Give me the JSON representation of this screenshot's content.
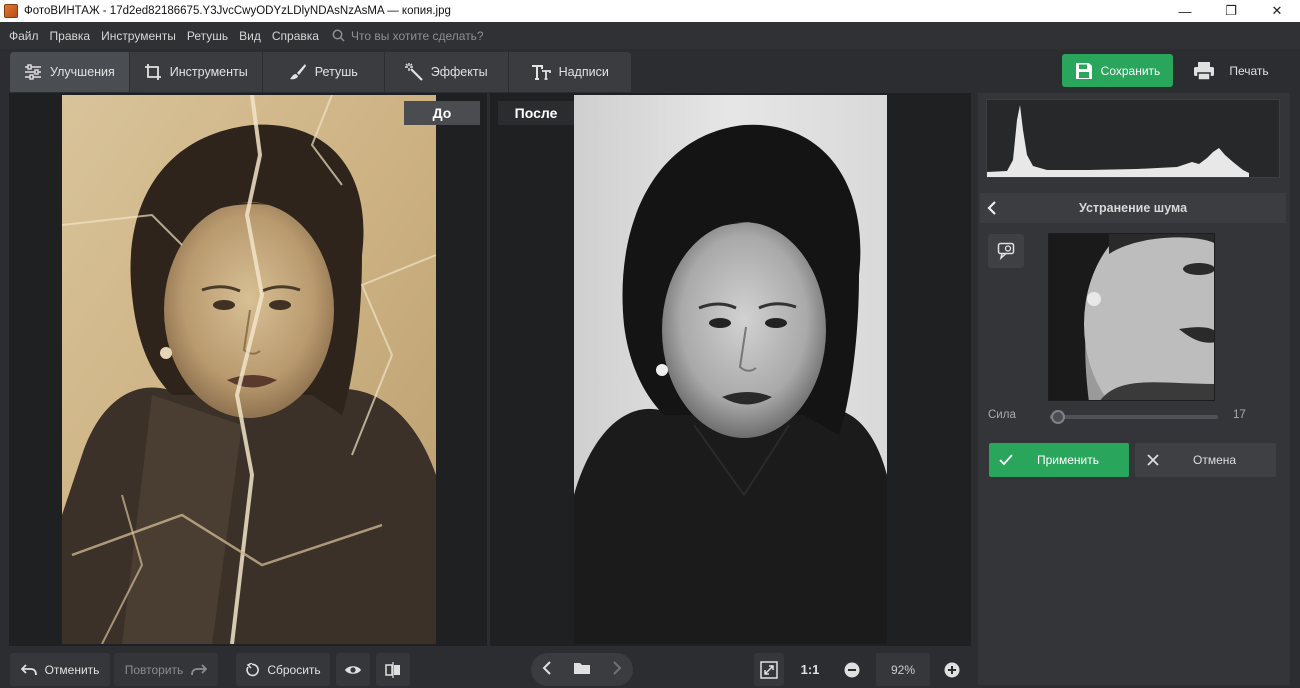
{
  "window": {
    "title": "ФотоВИНТАЖ - 17d2ed82186675.Y3JvcCwyODYzLDlyNDAsNzAsMA — копия.jpg",
    "minimize": "—",
    "maximize": "❐",
    "close": "✕"
  },
  "menu": {
    "items": [
      "Файл",
      "Правка",
      "Инструменты",
      "Ретушь",
      "Вид",
      "Справка"
    ],
    "search_placeholder": "Что вы хотите сделать?"
  },
  "tabs": [
    {
      "label": "Улучшения",
      "icon": "sliders-icon",
      "active": true
    },
    {
      "label": "Инструменты",
      "icon": "crop-icon",
      "active": false
    },
    {
      "label": "Ретушь",
      "icon": "brush-icon",
      "active": false
    },
    {
      "label": "Эффекты",
      "icon": "magic-wand-icon",
      "active": false
    },
    {
      "label": "Надписи",
      "icon": "text-icon",
      "active": false
    }
  ],
  "actions": {
    "save_label": "Сохранить",
    "print_label": "Печать"
  },
  "compare": {
    "before_label": "До",
    "after_label": "После"
  },
  "panel": {
    "title": "Устранение шума",
    "strength_label": "Сила",
    "strength_value": "17",
    "strength_fraction": 0.05,
    "apply_label": "Применить",
    "cancel_label": "Отмена"
  },
  "bottom": {
    "undo_label": "Отменить",
    "redo_label": "Повторить",
    "reset_label": "Сбросить",
    "actual_size_label": "1:1",
    "zoom_value": "92%"
  },
  "colors": {
    "accent_green": "#2aa65c",
    "background": "#2b2d30",
    "canvas": "#1e2022"
  }
}
